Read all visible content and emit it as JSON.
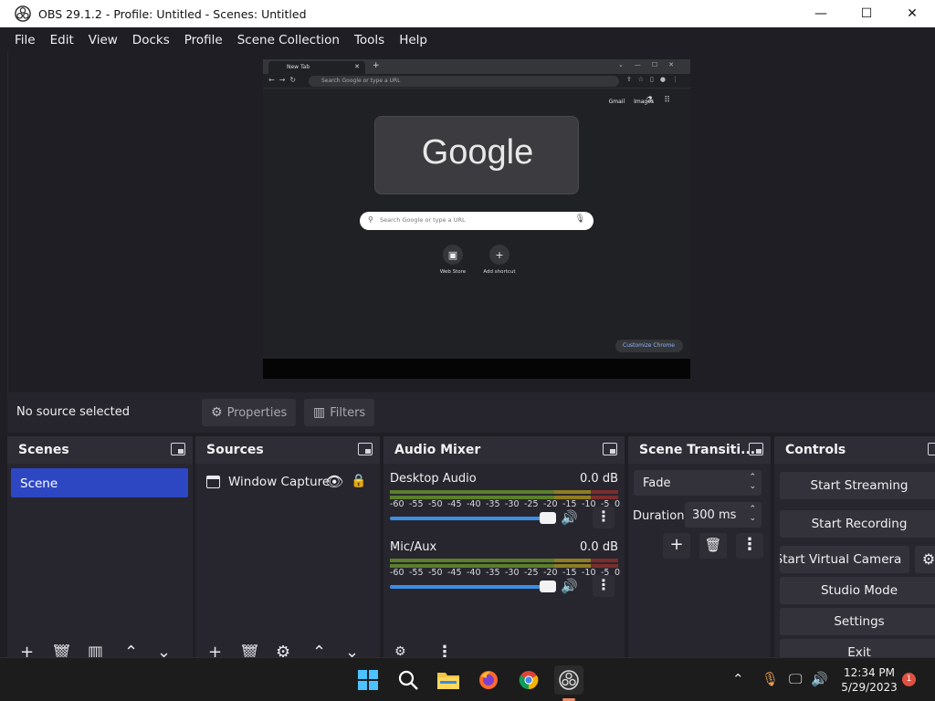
{
  "window": {
    "title": "OBS 29.1.2 - Profile: Untitled - Scenes: Untitled",
    "minimize": "—",
    "maximize": "☐",
    "close": "✕"
  },
  "menu": [
    "File",
    "Edit",
    "View",
    "Docks",
    "Profile",
    "Scene Collection",
    "Tools",
    "Help"
  ],
  "preview": {
    "tab_title": "New Tab",
    "omnibox_placeholder": "Search Google or type a URL",
    "link_gmail": "Gmail",
    "link_images": "Images",
    "logo_text": "Google",
    "search_placeholder": "Search Google or type a URL",
    "shortcuts": [
      "Web Store",
      "Add shortcut"
    ],
    "customize": "Customize Chrome"
  },
  "sourcebar": {
    "status": "No source selected",
    "properties": "Properties",
    "filters": "Filters"
  },
  "docks": {
    "scenes": {
      "title": "Scenes",
      "items": [
        "Scene"
      ]
    },
    "sources": {
      "title": "Sources",
      "items": [
        "Window Capture"
      ]
    },
    "audio": {
      "title": "Audio Mixer",
      "scale": [
        "-60",
        "-55",
        "-50",
        "-45",
        "-40",
        "-35",
        "-30",
        "-25",
        "-20",
        "-15",
        "-10",
        "-5",
        "0"
      ],
      "channels": [
        {
          "name": "Desktop Audio",
          "db": "0.0 dB",
          "volume": 1.0
        },
        {
          "name": "Mic/Aux",
          "db": "0.0 dB",
          "volume": 1.0
        }
      ]
    },
    "transitions": {
      "title": "Scene Transiti...",
      "selected": "Fade",
      "duration_label": "Duration",
      "duration": "300 ms"
    },
    "controls": {
      "title": "Controls",
      "start_streaming": "Start Streaming",
      "start_recording": "Start Recording",
      "start_virtual_camera": "Start Virtual Camera",
      "studio_mode": "Studio Mode",
      "settings": "Settings",
      "exit": "Exit"
    }
  },
  "taskbar": {
    "time": "12:34 PM",
    "date": "5/29/2023",
    "notifications": "1"
  },
  "colors": {
    "accent": "#2d47c2",
    "slider": "#3d8ee6",
    "background": "#1f1e25",
    "dock": "#27262e"
  }
}
